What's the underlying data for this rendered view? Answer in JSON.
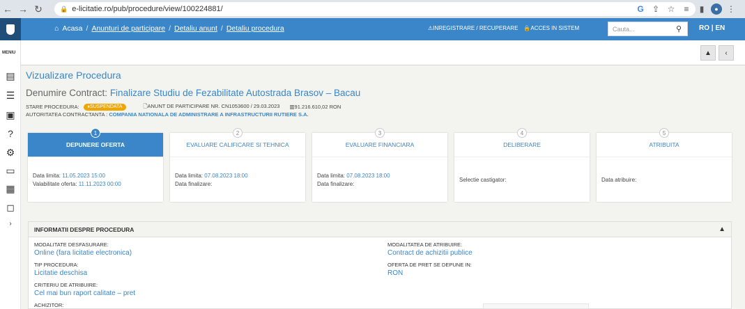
{
  "browser": {
    "url": "e-licitatie.ro/pub/procedure/view/100224881/",
    "nav": {
      "back": "←",
      "forward": "→",
      "reload": "↻"
    },
    "icons": [
      "google-icon",
      "share-icon",
      "star-icon",
      "playlist-icon",
      "sidepanel-icon",
      "profile-icon",
      "more-icon"
    ]
  },
  "topbar": {
    "breadcrumbs": [
      "Acasa",
      "Anunturi de participare",
      "Detaliu anunt",
      "Detaliu procedura"
    ],
    "register": "INREGISTRARE / RECUPERARE",
    "login": "ACCES IN SISTEM",
    "search_placeholder": "Cauta...",
    "lang": "RO | EN"
  },
  "sidebar": {
    "menu_label": "MENIU",
    "icons": [
      "document-icon",
      "list-export-icon",
      "folder-refresh-icon",
      "help-icon",
      "user-settings-icon",
      "id-card-icon",
      "monitor-report-icon",
      "chat-icon",
      "chevron-right-icon"
    ]
  },
  "page": {
    "title": "Vizualizare Procedura",
    "contract_label": "Denumire Contract:",
    "contract_name": "Finalizare Studiu de Fezabilitate Autostrada Brasov – Bacau",
    "status_label": "STARE PROCEDURA:",
    "status_value": "SUSPENDATA",
    "notice": "ANUNT DE PARTICIPARE NR. CN1053600 / 29.03.2023",
    "value": "91.216.610,02 RON",
    "authority_label": "AUTORITATEA CONTRACTANTA :",
    "authority_name": "COMPANIA NATIONALA DE ADMINISTRARE A INFRASTRUCTURII RUTIERE S.A."
  },
  "steps": [
    {
      "num": "1",
      "title": "DEPUNERE OFERTA",
      "l1": "Data limita:",
      "v1": "11.05.2023 15:00",
      "l2": "Valabilitate oferta:",
      "v2": "11.11.2023 00:00"
    },
    {
      "num": "2",
      "title": "EVALUARE CALIFICARE SI TEHNICA",
      "l1": "Data limita:",
      "v1": "07.08.2023 18:00",
      "l2": "Data finalizare:",
      "v2": ""
    },
    {
      "num": "3",
      "title": "EVALUARE FINANCIARA",
      "l1": "Data limita:",
      "v1": "07.08.2023 18:00",
      "l2": "Data finalizare:",
      "v2": ""
    },
    {
      "num": "4",
      "title": "DELIBERARE",
      "l1": "Selectie castigator:",
      "v1": "",
      "l2": "",
      "v2": ""
    },
    {
      "num": "5",
      "title": "ATRIBUITA",
      "l1": "Data atribuire:",
      "v1": "",
      "l2": "",
      "v2": ""
    }
  ],
  "info": {
    "heading": "INFORMATII DESPRE PROCEDURA",
    "modalitate_label": "MODALITATE DESFASURARE:",
    "modalitate_value": "Online (fara licitatie electronica)",
    "tip_label": "TIP PROCEDURA:",
    "tip_value": "Licitatie deschisa",
    "criteriu_label": "CRITERIU DE ATRIBUIRE:",
    "criteriu_value": "Cel mai bun raport calitate – pret",
    "achizitor_label": "ACHIZITOR:",
    "atribuire_label": "MODALITATEA DE ATRIBUIRE:",
    "atribuire_value": "Contract de achizitii publice",
    "oferta_label": "OFERTA DE PRET SE DEPUNE IN:",
    "oferta_value": "RON"
  }
}
